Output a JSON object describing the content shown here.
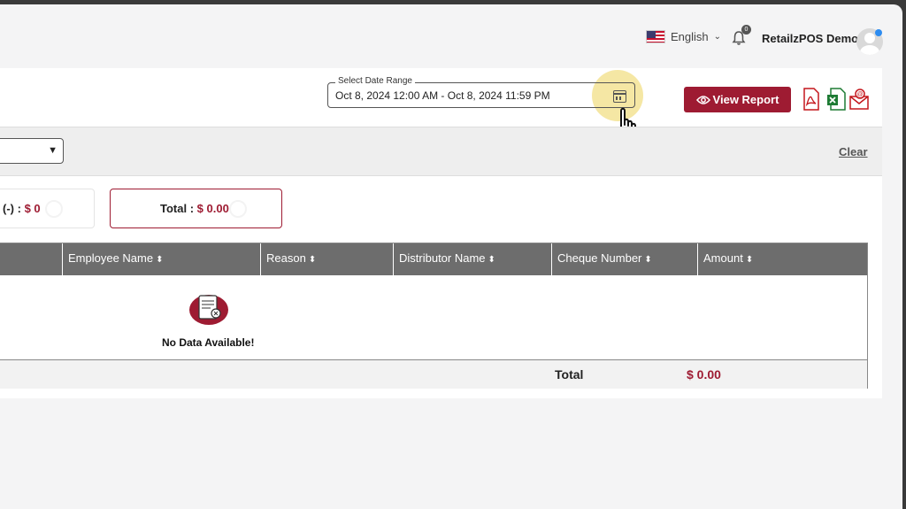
{
  "header": {
    "language": "English",
    "notification_count": "0",
    "user_name": "RetailzPOS Demo"
  },
  "toolbar": {
    "date_range_label": "Select Date Range",
    "date_range_value": "Oct 8, 2024 12:00 AM - Oct 8, 2024 11:59 PM",
    "view_report_label": "View Report",
    "export_icons": [
      "pdf-export-icon",
      "excel-export-icon",
      "email-export-icon"
    ]
  },
  "filters": {
    "clear_label": "Clear"
  },
  "summary": {
    "left_label": "(-) :",
    "left_value": "$ 0",
    "total_label": "Total :",
    "total_value": "$ 0.00"
  },
  "table": {
    "columns": [
      "Employee Name",
      "Reason",
      "Distributor Name",
      "Cheque Number",
      "Amount"
    ],
    "empty_message": "No Data Available!",
    "footer_label": "Total",
    "footer_value": "$ 0.00"
  },
  "colors": {
    "accent": "#9e1b32",
    "table_header": "#6d6d6d",
    "highlight": "#ecd45a"
  }
}
